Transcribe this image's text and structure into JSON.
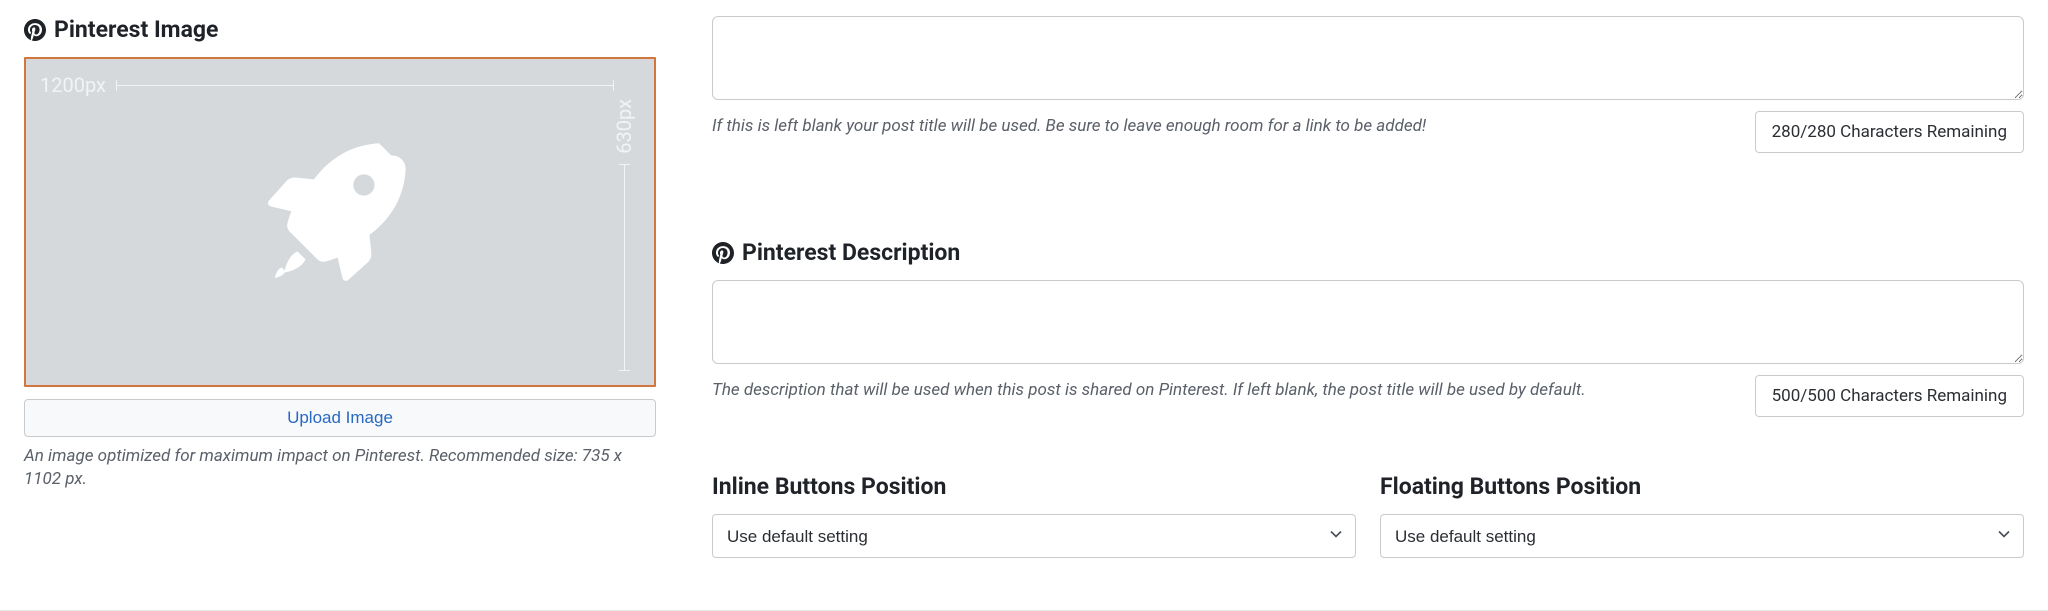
{
  "left": {
    "heading": "Pinterest Image",
    "placeholder_width_label": "1200px",
    "placeholder_height_label": "630px",
    "upload_button": "Upload Image",
    "help": "An image optimized for maximum impact on Pinterest. Recommended size: 735 x 1102 px."
  },
  "title_field": {
    "value": "",
    "help": "If this is left blank your post title will be used. Be sure to leave enough room for a link to be added!",
    "counter": "280/280 Characters Remaining"
  },
  "desc_field": {
    "heading": "Pinterest Description",
    "value": "",
    "help": "The description that will be used when this post is shared on Pinterest. If left blank, the post title will be used by default.",
    "counter": "500/500 Characters Remaining"
  },
  "inline_position": {
    "heading": "Inline Buttons Position",
    "selected": "Use default setting"
  },
  "floating_position": {
    "heading": "Floating Buttons Position",
    "selected": "Use default setting"
  }
}
